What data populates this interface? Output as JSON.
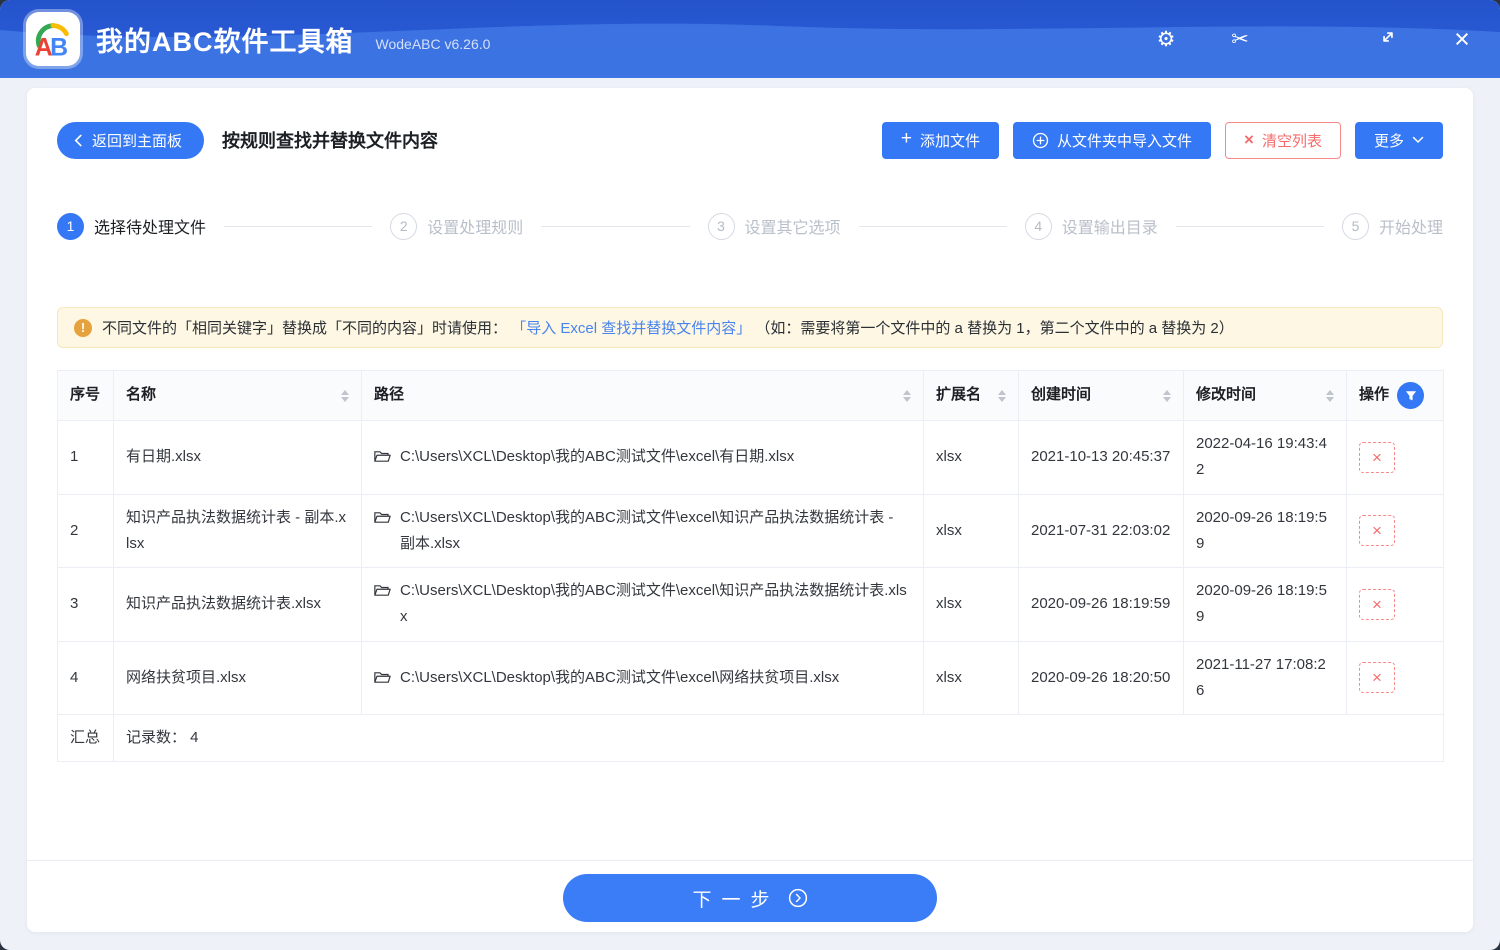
{
  "titlebar": {
    "logo_text": "AB",
    "app_title": "我的ABC软件工具箱",
    "version": "WodeABC v6.26.0"
  },
  "icons": {
    "gear": "⚙",
    "scissors": "✂",
    "close": "×",
    "plus": "+",
    "x_mark": "×",
    "delete_x": "×"
  },
  "header": {
    "back_label": "返回到主面板",
    "page_title": "按规则查找并替换文件内容",
    "add_files_label": "添加文件",
    "import_folder_label": "从文件夹中导入文件",
    "clear_list_label": "清空列表",
    "more_label": "更多"
  },
  "wizard": {
    "current_step": 1,
    "steps": [
      {
        "num": "1",
        "label": "选择待处理文件"
      },
      {
        "num": "2",
        "label": "设置处理规则"
      },
      {
        "num": "3",
        "label": "设置其它选项"
      },
      {
        "num": "4",
        "label": "设置输出目录"
      },
      {
        "num": "5",
        "label": "开始处理"
      }
    ]
  },
  "notice": {
    "text_before": "不同文件的「相同关键字」替换成「不同的内容」时请使用：",
    "link_text": "「导入 Excel 查找并替换文件内容」",
    "text_after": "（如：需要将第一个文件中的 a 替换为 1，第二个文件中的 a 替换为 2）"
  },
  "table": {
    "headers": {
      "index": "序号",
      "name": "名称",
      "path": "路径",
      "ext": "扩展名",
      "created": "创建时间",
      "modified": "修改时间",
      "action": "操作"
    },
    "rows": [
      {
        "index": "1",
        "name": "有日期.xlsx",
        "path": "C:\\Users\\XCL\\Desktop\\我的ABC测试文件\\excel\\有日期.xlsx",
        "ext": "xlsx",
        "created": "2021-10-13 20:45:37",
        "modified": "2022-04-16 19:43:42"
      },
      {
        "index": "2",
        "name": "知识产品执法数据统计表 - 副本.xlsx",
        "path": "C:\\Users\\XCL\\Desktop\\我的ABC测试文件\\excel\\知识产品执法数据统计表 - 副本.xlsx",
        "ext": "xlsx",
        "created": "2021-07-31 22:03:02",
        "modified": "2020-09-26 18:19:59"
      },
      {
        "index": "3",
        "name": "知识产品执法数据统计表.xlsx",
        "path": "C:\\Users\\XCL\\Desktop\\我的ABC测试文件\\excel\\知识产品执法数据统计表.xlsx",
        "ext": "xlsx",
        "created": "2020-09-26 18:19:59",
        "modified": "2020-09-26 18:19:59"
      },
      {
        "index": "4",
        "name": "网络扶贫项目.xlsx",
        "path": "C:\\Users\\XCL\\Desktop\\我的ABC测试文件\\excel\\网络扶贫项目.xlsx",
        "ext": "xlsx",
        "created": "2020-09-26 18:20:50",
        "modified": "2021-11-27 17:08:26"
      }
    ],
    "summary": {
      "label": "汇总",
      "text": "记录数： 4"
    }
  },
  "footer": {
    "next_label": "下一步"
  },
  "colors": {
    "accent": "#3478f5",
    "danger": "#f56c6c",
    "warning": "#e6a23c",
    "titlebar_dark": "#2453cc",
    "titlebar_light": "#4077e4"
  }
}
